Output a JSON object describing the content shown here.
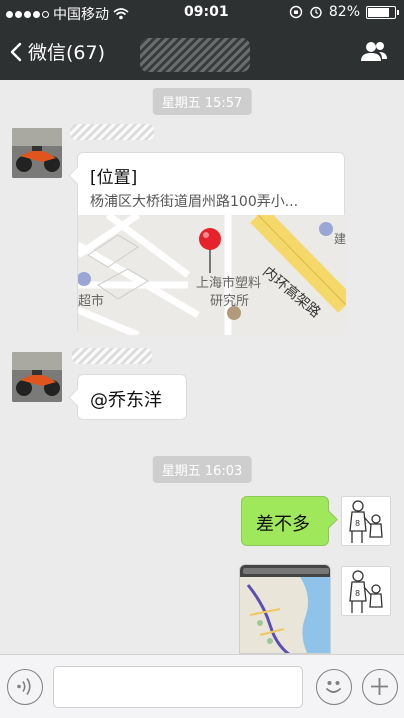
{
  "status_bar": {
    "carrier": "中国移动",
    "time": "09:01",
    "battery": "82%",
    "battery_level": 0.82,
    "signal_bars_filled": 4
  },
  "nav": {
    "back_label": "微信(67)"
  },
  "messages": {
    "ts1": "星期五 15:57",
    "location": {
      "title": "[位置]",
      "address": "杨浦区大桥街道眉州路100弄小...",
      "map_road": "内环高架路",
      "map_poi": "上海市塑料\n研究所",
      "map_poi_line1": "上海市塑料",
      "map_poi_line2": "研究所",
      "map_supermarket": "超市",
      "map_building": "建"
    },
    "mention": "@乔东洋",
    "ts2": "星期五 16:03",
    "reply": "差不多"
  },
  "colors": {
    "nav_bg": "#2e3132",
    "chat_bg": "#ebebeb",
    "green_bubble": "#9fe75b",
    "timestamp_bg": "#cecece",
    "map_road": "#f5d86a"
  },
  "icons": {
    "back": "chevron-left-icon",
    "contacts": "person-group-icon",
    "voice": "voice-icon",
    "emoji": "emoji-icon",
    "plus": "plus-icon"
  }
}
